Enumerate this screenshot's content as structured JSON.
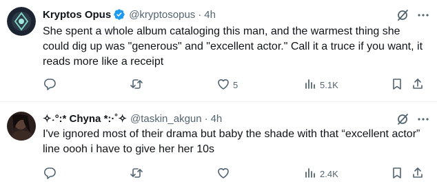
{
  "tweets": [
    {
      "author_name": "Kryptos Opus",
      "handle": "@kryptosopus",
      "separator": "·",
      "time": "4h",
      "verified": true,
      "text": "She spent a whole album cataloging this man, and the warmest thing she could dig up was \"generous\" and \"excellent actor.\" Call it a truce if you want, it reads more like a receipt",
      "likes": "5",
      "views": "5.1K"
    },
    {
      "author_name": "✧˖°:* Chyna *:·˚✧",
      "handle": "@taskin_akgun",
      "separator": "·",
      "time": "4h",
      "verified": false,
      "text": "I've ignored most of their drama but baby the shade with that “excellent actor” line oooh i have to give her her 10s",
      "likes": "",
      "views": "2.4K"
    }
  ],
  "colors": {
    "text": "#0f1419",
    "secondary": "#536471",
    "verified": "#1d9bf0",
    "divider": "#eff3f4"
  },
  "icons": [
    "reply-icon",
    "retweet-icon",
    "like-icon",
    "views-icon",
    "bookmark-icon",
    "share-icon",
    "grok-icon",
    "more-icon",
    "verified-badge-icon"
  ]
}
